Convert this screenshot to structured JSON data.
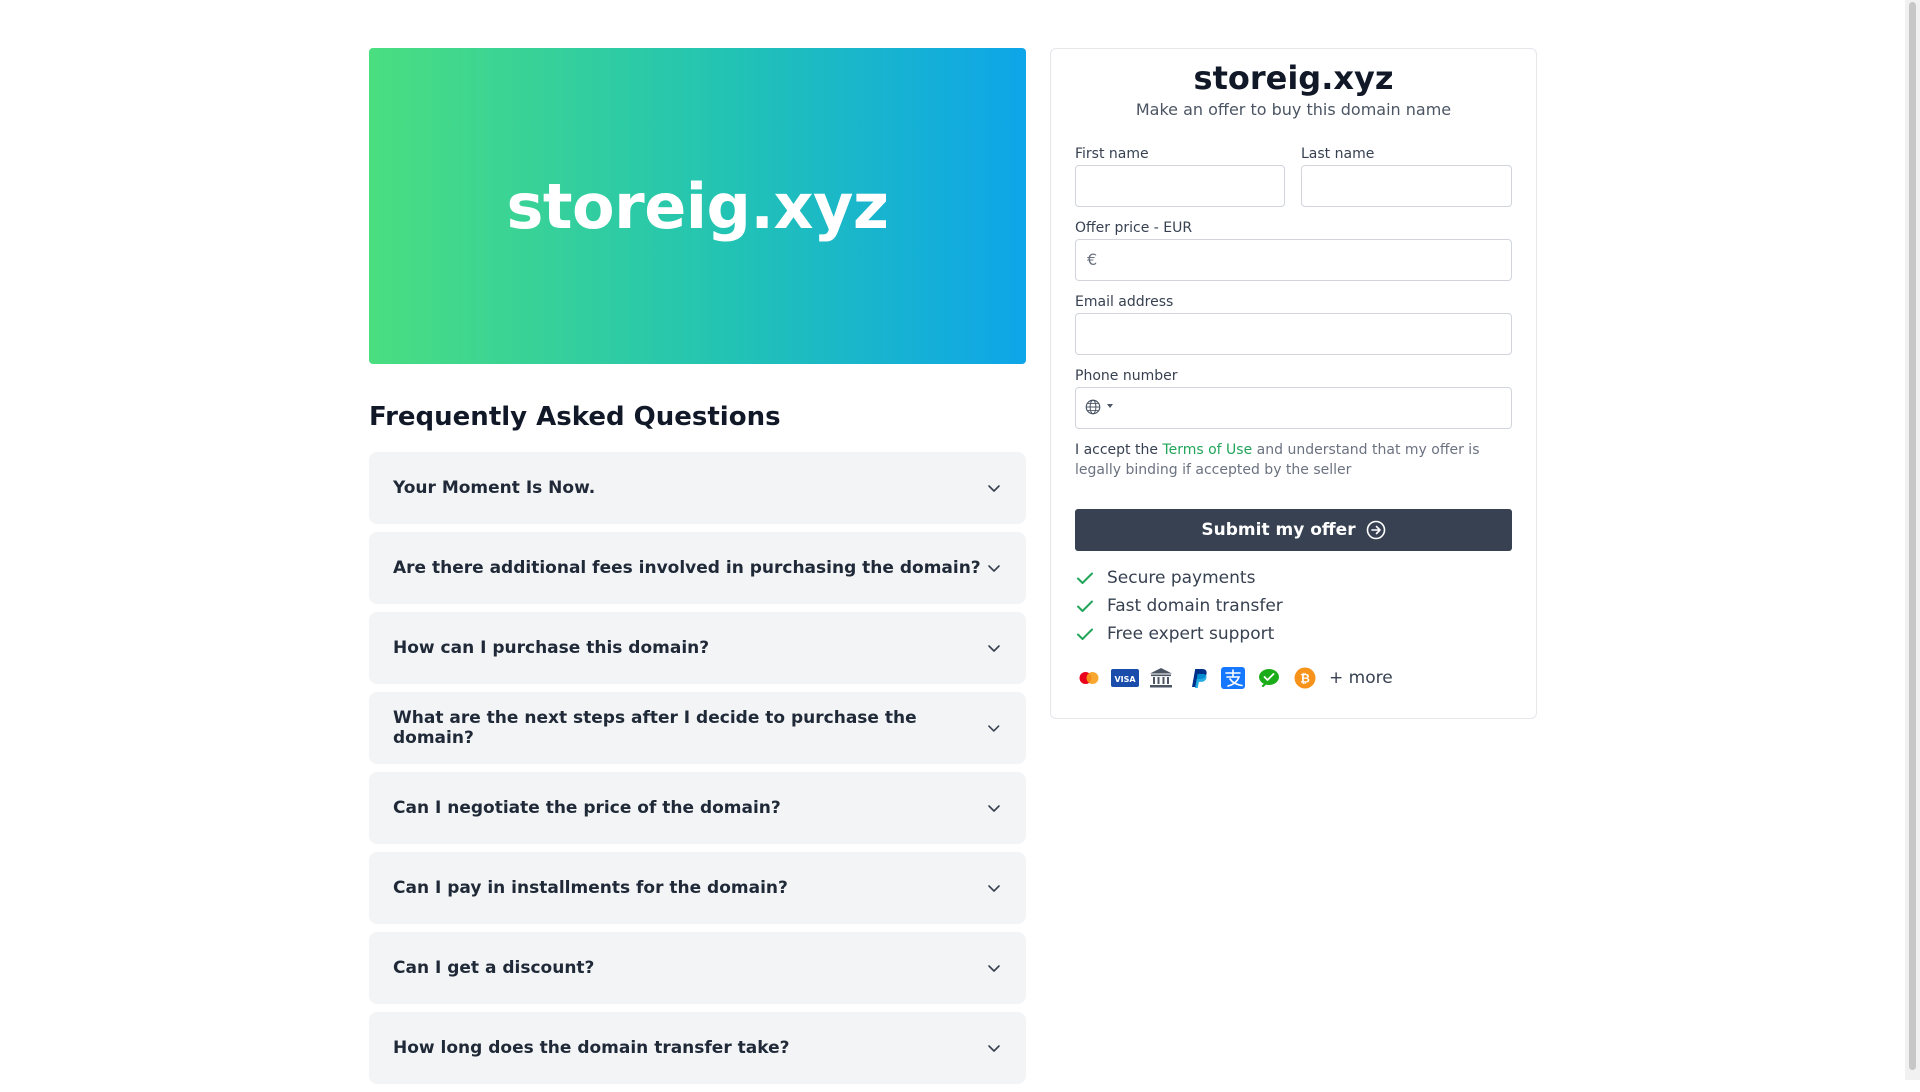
{
  "hero": {
    "domain": "storeig.xyz"
  },
  "faq": {
    "heading": "Frequently Asked Questions",
    "items": [
      "Your Moment Is Now.",
      "Are there additional fees involved in purchasing the domain?",
      "How can I purchase this domain?",
      "What are the next steps after I decide to purchase the domain?",
      "Can I negotiate the price of the domain?",
      "Can I pay in installments for the domain?",
      "Can I get a discount?",
      "How long does the domain transfer take?"
    ]
  },
  "offer": {
    "title": "storeig.xyz",
    "subtitle": "Make an offer to buy this domain name",
    "first_name_label": "First name",
    "last_name_label": "Last name",
    "price_label": "Offer price - EUR",
    "currency_symbol": "€",
    "email_label": "Email address",
    "phone_label": "Phone number",
    "terms_prefix": "I accept the",
    "terms_link": "Terms of Use",
    "terms_suffix": "and understand that my offer is legally binding if accepted by the seller",
    "submit_label": "Submit my offer",
    "features": [
      "Secure payments",
      "Fast domain transfer",
      "Free expert support"
    ],
    "payment_icons": [
      "mastercard-icon",
      "visa-icon",
      "bank-transfer-icon",
      "paypal-icon",
      "alipay-icon",
      "wechat-pay-icon",
      "bitcoin-icon"
    ],
    "more_label": "+ more"
  },
  "colors": {
    "accent_green": "#22a55b",
    "button_dark": "#374151",
    "gradient_start": "#4ade80",
    "gradient_end": "#0ea5e9"
  }
}
